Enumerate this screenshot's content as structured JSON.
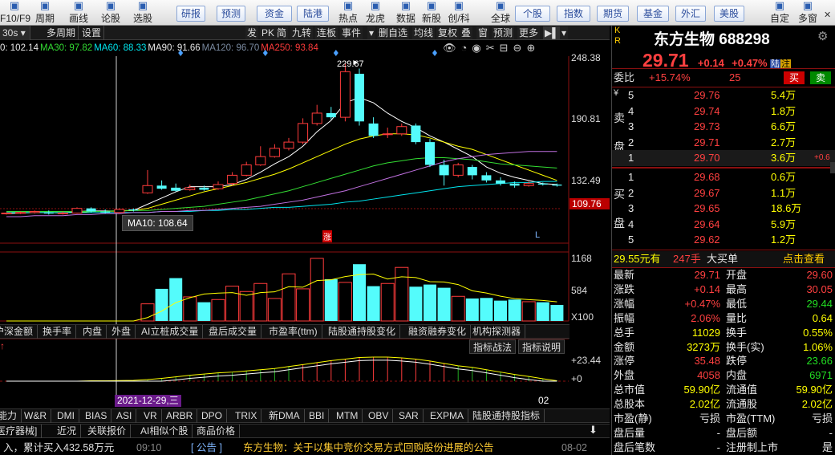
{
  "toolbar": {
    "items": [
      {
        "label": "F10/F9",
        "icon": "f10-icon"
      },
      {
        "label": "周期",
        "icon": "clock-icon"
      },
      {
        "label": "画线",
        "icon": "pen-icon"
      },
      {
        "label": "论股",
        "icon": "chat-icon"
      },
      {
        "label": "选股",
        "icon": "filter-icon"
      }
    ],
    "buttons1": [
      "研报",
      "预测",
      "资金",
      "陆港"
    ],
    "items2": [
      {
        "label": "热点",
        "icon": "fire-icon"
      },
      {
        "label": "龙虎",
        "icon": "dragon-icon"
      },
      {
        "label": "数据",
        "icon": "data-icon"
      },
      {
        "label": "新股",
        "icon": "new-icon"
      },
      {
        "label": "创/科",
        "icon": "star-icon"
      },
      {
        "label": "全球",
        "icon": "globe-icon"
      }
    ],
    "buttons2": [
      "个股",
      "指数",
      "期货",
      "基金",
      "外汇",
      "美股"
    ],
    "items3": [
      {
        "label": "自定",
        "icon": "custom-icon"
      },
      {
        "label": "多窗",
        "icon": "windows-icon"
      }
    ]
  },
  "ctrl": {
    "period": "30s",
    "multi": "多周期",
    "settings": "设置",
    "right": [
      "发",
      "PK",
      "简",
      "九转",
      "连板",
      "事件",
      "删自选",
      "均线",
      "复权",
      "叠",
      "窗",
      "预测",
      "更多"
    ]
  },
  "ma": [
    {
      "t": "0: 102.14",
      "c": "#e8e8e8"
    },
    {
      "t": "MA30: 97.82",
      "c": "#33dd33"
    },
    {
      "t": "MA60: 88.33",
      "c": "#00e5ee"
    },
    {
      "t": "MA90: 91.66",
      "c": "#e8e8e8"
    },
    {
      "t": "MA120: 96.70",
      "c": "#7a8aa0"
    },
    {
      "t": "MA250: 93.84",
      "c": "#ff3b3b"
    }
  ],
  "price_axis": [
    "248.38",
    "190.81",
    "132.49",
    "109.76"
  ],
  "high_label": "229.67",
  "tooltip": "MA10: 108.64",
  "zhang": "涨",
  "vol_axis": [
    "1168",
    "584",
    "X100"
  ],
  "tabs1": [
    "沪深金额",
    "换手率",
    "内盘",
    "外盘",
    "AI立桩成交量",
    "盘后成交量",
    "市盈率(ttm)",
    "陆股通持股变化",
    "融资融券变化",
    "机构探测器"
  ],
  "ind_btns": [
    "指标战法",
    "指标说明"
  ],
  "ind_axis": [
    "+23.44",
    "+0"
  ],
  "date_label": "2021-12-29,三",
  "date_right": "02",
  "tabs2": [
    "能力",
    "W&R",
    "DMI",
    "BIAS",
    "ASI",
    "VR",
    "ARBR",
    "DPO",
    "TRIX",
    "新DMA",
    "BBI",
    "MTM",
    "OBV",
    "SAR",
    "EXPMA",
    "陆股通持股指标"
  ],
  "tabs3": [
    "医疗器械]",
    "近况",
    "关联报价",
    "AI相似个股",
    "商品价格"
  ],
  "news": {
    "left": "入，累计买入432.58万元",
    "time": "09:10",
    "tag": "公告",
    "title": "东方生物：关于以集中竞价交易方式回购股份进展的公告",
    "date": "08-02"
  },
  "quote": {
    "kr": [
      "K",
      "R"
    ],
    "name": "东方生物",
    "code": "688298",
    "price": "29.71",
    "chg": "+0.14",
    "pct": "+0.47%",
    "badges": [
      "陆",
      "注"
    ],
    "weibi_label": "委比",
    "weibi": "+15.74%",
    "weicha": "25",
    "buy": "买",
    "sell": "卖",
    "sell_label": [
      "卖",
      "盘"
    ],
    "buy_label": [
      "买",
      "盘"
    ],
    "asks": [
      {
        "n": "5",
        "p": "29.76",
        "v": "5.4万"
      },
      {
        "n": "4",
        "p": "29.74",
        "v": "1.8万"
      },
      {
        "n": "3",
        "p": "29.73",
        "v": "6.6万"
      },
      {
        "n": "2",
        "p": "29.71",
        "v": "2.7万"
      },
      {
        "n": "1",
        "p": "29.70",
        "v": "3.6万",
        "x": "+0.6"
      }
    ],
    "bids": [
      {
        "n": "1",
        "p": "29.68",
        "v": "0.6万"
      },
      {
        "n": "2",
        "p": "29.67",
        "v": "1.1万"
      },
      {
        "n": "3",
        "p": "29.65",
        "v": "18.6万"
      },
      {
        "n": "4",
        "p": "29.64",
        "v": "5.9万"
      },
      {
        "n": "5",
        "p": "29.62",
        "v": "1.2万"
      }
    ],
    "bigbuy": {
      "price": "29.55元有",
      "qty": "247手",
      "label": "大买单",
      "link": "点击查看"
    },
    "stats": [
      [
        "最新",
        "29.71",
        "red",
        "开盘",
        "29.60",
        "red"
      ],
      [
        "涨跌",
        "+0.14",
        "red",
        "最高",
        "30.05",
        "red"
      ],
      [
        "涨幅",
        "+0.47%",
        "red",
        "最低",
        "29.44",
        "green"
      ],
      [
        "振幅",
        "2.06%",
        "red",
        "量比",
        "0.64",
        "yel"
      ],
      [
        "总手",
        "11029",
        "yel",
        "换手",
        "0.55%",
        "yel"
      ],
      [
        "金额",
        "3273万",
        "yel",
        "换手(实)",
        "1.06%",
        "yel"
      ],
      [
        "涨停",
        "35.48",
        "red",
        "跌停",
        "23.66",
        "green"
      ],
      [
        "外盘",
        "4058",
        "red",
        "内盘",
        "6971",
        "green"
      ],
      [
        "总市值",
        "59.90亿",
        "yel",
        "流通值",
        "59.90亿",
        "yel"
      ],
      [
        "总股本",
        "2.02亿",
        "yel",
        "流通股",
        "2.02亿",
        "yel"
      ],
      [
        "市盈(静)",
        "亏损",
        "wht",
        "市盈(TTM)",
        "亏损",
        "wht"
      ],
      [
        "盘后量",
        "-",
        "wht",
        "盘后额",
        "-",
        "wht"
      ],
      [
        "盘后笔数",
        "-",
        "wht",
        "注册制上市",
        "是",
        "wht"
      ]
    ]
  },
  "colors": {
    "up": "#ff3b3b",
    "down": "#54fcfc",
    "bg": "#000000"
  },
  "chart_data": {
    "type": "candlestick",
    "price_range": [
      100,
      255
    ],
    "candles": [
      [
        103,
        103.5,
        102,
        104
      ],
      [
        103.5,
        104,
        102.5,
        105
      ],
      [
        104,
        105,
        103,
        106
      ],
      [
        104,
        103,
        102,
        106
      ],
      [
        103,
        103.5,
        102,
        105
      ],
      [
        103.5,
        108,
        103,
        109
      ],
      [
        108,
        105,
        104,
        109
      ],
      [
        105,
        104,
        103,
        107
      ],
      [
        104,
        107,
        103,
        108
      ],
      [
        107,
        106,
        105,
        108
      ],
      [
        123,
        130,
        122,
        145
      ],
      [
        130,
        127,
        126,
        135
      ],
      [
        128,
        125,
        124,
        132
      ],
      [
        126,
        128,
        125,
        131
      ],
      [
        128,
        126,
        125,
        130
      ],
      [
        127,
        131,
        126,
        134
      ],
      [
        132,
        140,
        130,
        143
      ],
      [
        140,
        150,
        139,
        153
      ],
      [
        150,
        158,
        149,
        168
      ],
      [
        158,
        166,
        157,
        170
      ],
      [
        166,
        172,
        164,
        176
      ],
      [
        172,
        190,
        170,
        195
      ],
      [
        190,
        200,
        188,
        208
      ],
      [
        200,
        196,
        194,
        206
      ],
      [
        196,
        240,
        192,
        248
      ],
      [
        238,
        192,
        188,
        243
      ],
      [
        190,
        178,
        176,
        196
      ],
      [
        180,
        180,
        176,
        186
      ],
      [
        180,
        187,
        178,
        190
      ],
      [
        188,
        172,
        170,
        190
      ],
      [
        172,
        150,
        148,
        175
      ],
      [
        150,
        140,
        130,
        155
      ],
      [
        140,
        150,
        138,
        152
      ],
      [
        148,
        140,
        136,
        150
      ],
      [
        140,
        135,
        133,
        143
      ],
      [
        135,
        132,
        130,
        138
      ],
      [
        132,
        130,
        128,
        134
      ],
      [
        130,
        132,
        129,
        134
      ],
      [
        132,
        131,
        130,
        133
      ],
      [
        131,
        130,
        129,
        132
      ]
    ],
    "volumes": [
      0,
      0,
      0,
      0,
      0,
      0,
      0,
      0,
      0,
      0,
      320,
      600,
      800,
      450,
      350,
      400,
      650,
      550,
      700,
      420,
      880,
      600,
      1168,
      780,
      720,
      1060,
      650,
      700,
      1000,
      640,
      680,
      620,
      460,
      420,
      430,
      380,
      400,
      360,
      350,
      300
    ],
    "vol_range": [
      0,
      1168
    ],
    "ma_lines": {
      "MA5": [
        103,
        103.5,
        104,
        104,
        103.5,
        105,
        105.5,
        105.5,
        105.5,
        106,
        112,
        118,
        124,
        129,
        129,
        129,
        131,
        136,
        143,
        151,
        158,
        168,
        182,
        193,
        210,
        215,
        210,
        200,
        192,
        186,
        178,
        172,
        165,
        158,
        148,
        142,
        138,
        135,
        132,
        131
      ],
      "MA10": [
        104,
        104,
        104,
        104,
        104,
        104,
        105,
        105,
        105.5,
        106,
        108,
        112,
        116,
        120,
        124,
        127,
        130,
        133,
        137,
        141,
        146,
        152,
        158,
        164,
        170,
        175,
        178,
        180,
        180,
        179,
        176,
        172,
        168,
        165,
        160,
        155,
        150,
        145,
        140,
        135
      ],
      "MA30": [
        105,
        105,
        105,
        105,
        105,
        105,
        105,
        105,
        106,
        106,
        106,
        107,
        108,
        109,
        110,
        112,
        114,
        116,
        119,
        122,
        125,
        129,
        133,
        137,
        141,
        145,
        149,
        152,
        154,
        156,
        157,
        157,
        156,
        155,
        153,
        151,
        150,
        149,
        148,
        147
      ],
      "MA60": [
        104,
        104,
        104,
        104,
        104,
        104,
        104,
        104,
        104,
        104,
        104,
        105,
        105,
        105,
        106,
        106,
        107,
        107,
        108,
        109,
        109,
        110,
        111,
        112,
        114,
        115,
        117,
        119,
        121,
        123,
        125,
        127,
        129,
        130,
        131,
        132,
        133,
        133,
        134,
        134
      ],
      "MA120": [
        100,
        100,
        101,
        101,
        101,
        102,
        102,
        103,
        103,
        104,
        104,
        105,
        105,
        106,
        106,
        107,
        108,
        109,
        110,
        112,
        114,
        116,
        119,
        122,
        125,
        129,
        133,
        137,
        141,
        145,
        149,
        153,
        156,
        158,
        160,
        161,
        162,
        163,
        163,
        163
      ]
    }
  }
}
